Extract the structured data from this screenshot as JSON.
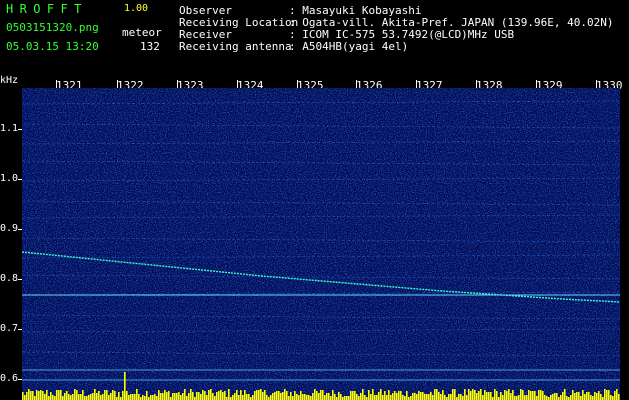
{
  "header": {
    "app_title": "HROFFT",
    "app_version": "1.00",
    "file_name": "0503151320.png",
    "mode": "meteor",
    "datetime": "05.03.15 13:20",
    "count": "132"
  },
  "station_info": [
    {
      "label": "Observer",
      "value": ": Masayuki Kobayashi"
    },
    {
      "label": "Receiving Location",
      "value": ": Ogata-vill. Akita-Pref. JAPAN (139.96E, 40.02N)"
    },
    {
      "label": "Receiver",
      "value": ": ICOM IC-575 53.7492(@LCD)MHz USB"
    },
    {
      "label": "Receiving antenna",
      "value": ": A504HB(yagi 4el)"
    }
  ],
  "time_axis": {
    "labels": [
      "1321",
      "1322",
      "1323",
      "1324",
      "1325",
      "1326",
      "1327",
      "1328",
      "1329",
      "1330"
    ]
  },
  "freq_axis": {
    "unit": "kHz",
    "labels": [
      "1.1",
      "1.0",
      "0.9",
      "0.8",
      "0.7",
      "0.6"
    ]
  },
  "colors": {
    "header_green": "#33ff33",
    "header_yellow": "#ffff33",
    "background_blue": "#000c5a",
    "trace_color": "#33ffcc",
    "activity_bars": "#ffff00"
  }
}
